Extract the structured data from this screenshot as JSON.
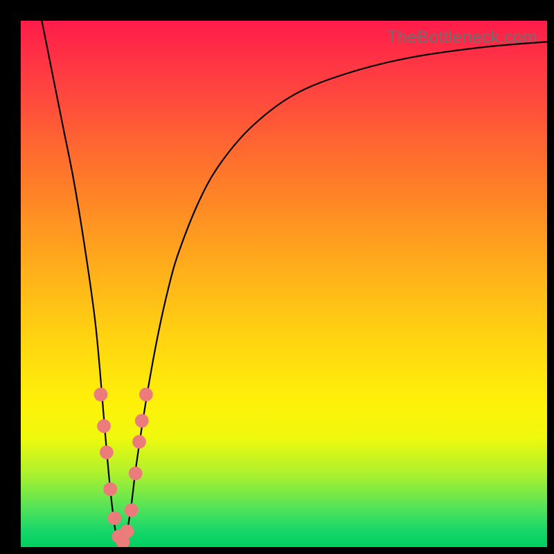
{
  "watermark": "TheBottleneck.com",
  "chart_data": {
    "type": "line",
    "title": "",
    "xlabel": "",
    "ylabel": "",
    "xlim": [
      0,
      100
    ],
    "ylim": [
      0,
      100
    ],
    "grid": false,
    "legend": false,
    "background_gradient": {
      "direction": "top-to-bottom",
      "stops": [
        {
          "pos": 0,
          "color": "#ff1c4a"
        },
        {
          "pos": 50,
          "color": "#ffd311"
        },
        {
          "pos": 100,
          "color": "#00cf5f"
        }
      ]
    },
    "series": [
      {
        "name": "bottleneck-curve",
        "color": "#000000",
        "x": [
          4,
          6,
          8,
          10,
          12,
          14,
          15,
          16,
          17,
          18,
          19,
          20,
          21,
          22,
          24,
          26,
          28,
          30,
          34,
          38,
          44,
          52,
          62,
          74,
          88,
          100
        ],
        "y": [
          100,
          90,
          80,
          70,
          58,
          44,
          34,
          22,
          11,
          3,
          0,
          2,
          8,
          16,
          29,
          40,
          49,
          56,
          66,
          73,
          80,
          86,
          90,
          93,
          95,
          96
        ]
      }
    ],
    "annotations": {
      "beads": {
        "color": "#ec7b7b",
        "radius": 1.3,
        "points": [
          {
            "x": 15.2,
            "y": 29
          },
          {
            "x": 15.8,
            "y": 23
          },
          {
            "x": 16.3,
            "y": 18
          },
          {
            "x": 17.0,
            "y": 11
          },
          {
            "x": 17.8,
            "y": 5.5
          },
          {
            "x": 18.6,
            "y": 2
          },
          {
            "x": 19.4,
            "y": 1
          },
          {
            "x": 20.2,
            "y": 3
          },
          {
            "x": 21.0,
            "y": 7
          },
          {
            "x": 21.8,
            "y": 14
          },
          {
            "x": 22.5,
            "y": 20
          },
          {
            "x": 23.0,
            "y": 24
          },
          {
            "x": 23.8,
            "y": 29
          }
        ]
      }
    }
  }
}
